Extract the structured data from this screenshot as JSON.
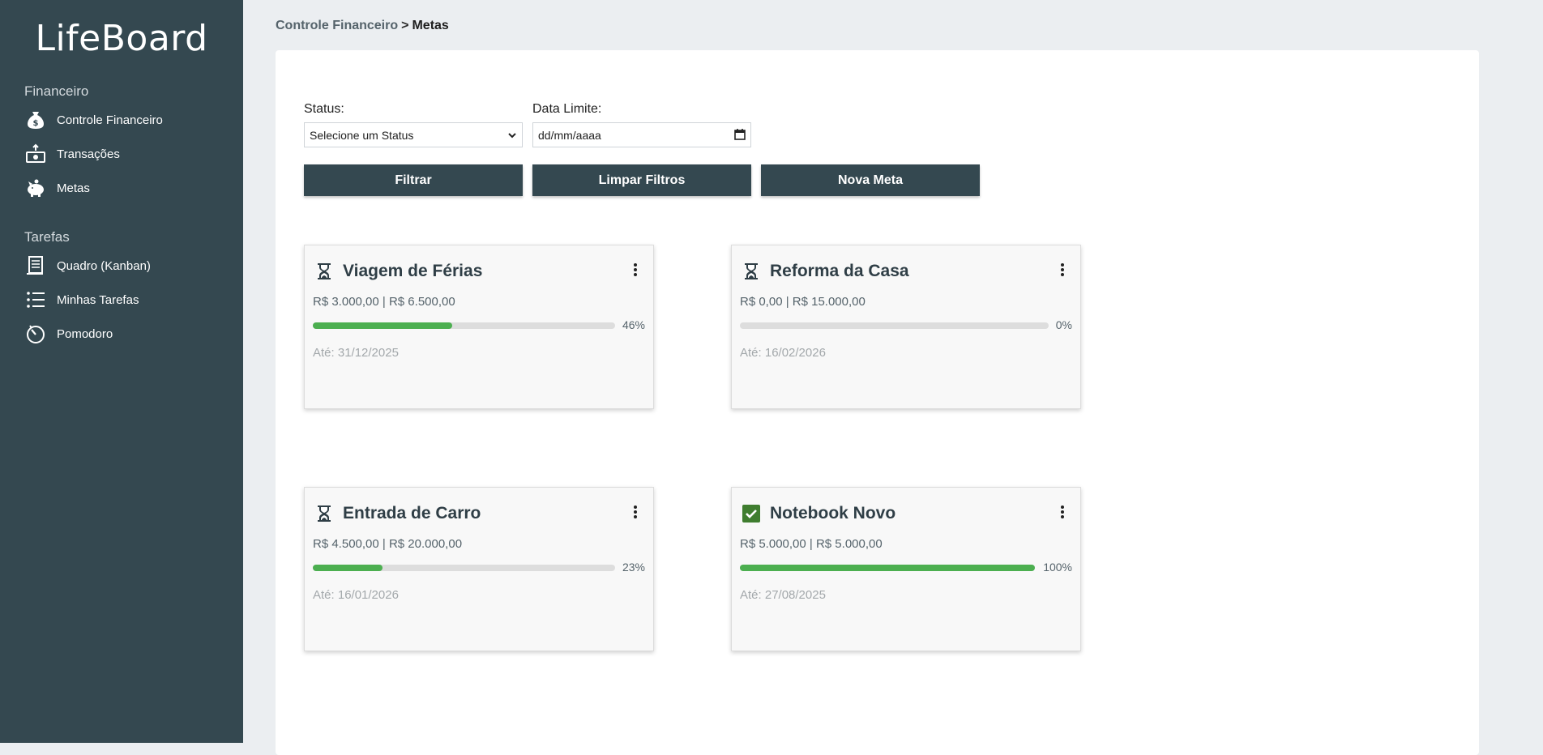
{
  "app": {
    "name": "LifeBoard"
  },
  "sidebar": {
    "sections": [
      {
        "title": "Financeiro",
        "items": [
          {
            "label": "Controle Financeiro",
            "icon": "money-bag-icon"
          },
          {
            "label": "Transações",
            "icon": "cash-transfer-icon"
          },
          {
            "label": "Metas",
            "icon": "piggy-bank-icon"
          }
        ]
      },
      {
        "title": "Tarefas",
        "items": [
          {
            "label": "Quadro (Kanban)",
            "icon": "kanban-board-icon"
          },
          {
            "label": "Minhas Tarefas",
            "icon": "task-list-icon"
          },
          {
            "label": "Pomodoro",
            "icon": "timer-icon"
          }
        ]
      }
    ]
  },
  "breadcrumb": {
    "parent": "Controle Financeiro",
    "separator": ">",
    "current": "Metas"
  },
  "filters": {
    "status_label": "Status:",
    "status_value": "Selecione um Status",
    "date_label": "Data Limite:",
    "date_placeholder": "dd/mm/aaaa",
    "filter_button": "Filtrar",
    "clear_button": "Limpar Filtros",
    "new_button": "Nova Meta"
  },
  "goals": [
    {
      "title": "Viagem de Férias",
      "amount": "R$ 3.000,00 | R$ 6.500,00",
      "percent_label": "46%",
      "progress": 0.46,
      "due": "Até: 31/12/2025",
      "status_icon": "hourglass-icon"
    },
    {
      "title": "Reforma da Casa",
      "amount": "R$ 0,00 | R$ 15.000,00",
      "percent_label": "0%",
      "progress": 0.0,
      "due": "Até: 16/02/2026",
      "status_icon": "hourglass-icon"
    },
    {
      "title": "Entrada de Carro",
      "amount": "R$ 4.500,00 | R$ 20.000,00",
      "percent_label": "23%",
      "progress": 0.23,
      "due": "Até: 16/01/2026",
      "status_icon": "hourglass-icon"
    },
    {
      "title": "Notebook Novo",
      "amount": "R$ 5.000,00 | R$ 5.000,00",
      "percent_label": "100%",
      "progress": 1.0,
      "due": "Até: 27/08/2025",
      "status_icon": "checkbox-checked-icon"
    }
  ],
  "colors": {
    "sidebar_bg": "#344850",
    "page_bg": "#ebeef1",
    "button_bg": "#344850",
    "progress_fill": "#4caf50",
    "progress_track": "#dddddd",
    "check_green": "#3f7d2f"
  }
}
